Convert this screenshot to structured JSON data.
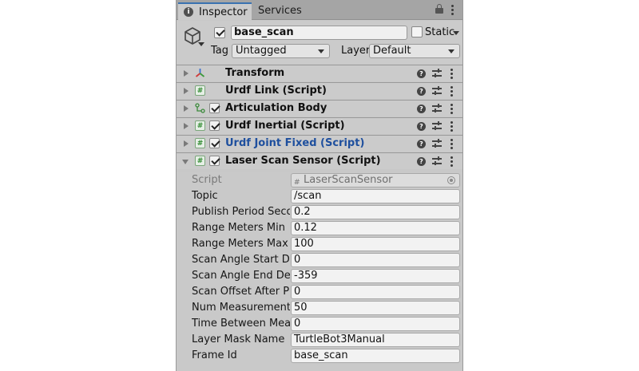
{
  "tabs": {
    "inspector": "Inspector",
    "services": "Services"
  },
  "header": {
    "object_name": "base_scan",
    "active": true,
    "static_label": "Static",
    "static_checked": false,
    "tag_label": "Tag",
    "tag_value": "Untagged",
    "layer_label": "Layer",
    "layer_value": "Default"
  },
  "components": [
    {
      "title": "Transform",
      "icon": "transform-icon",
      "has_checkbox": false,
      "checked": false
    },
    {
      "title": "Urdf Link (Script)",
      "icon": "script-icon",
      "has_checkbox": false,
      "checked": false
    },
    {
      "title": "Articulation Body",
      "icon": "articulation-icon",
      "has_checkbox": true,
      "checked": true
    },
    {
      "title": "Urdf Inertial (Script)",
      "icon": "script-icon",
      "has_checkbox": true,
      "checked": true
    },
    {
      "title": "Urdf Joint Fixed (Script)",
      "icon": "script-icon",
      "has_checkbox": true,
      "checked": true
    },
    {
      "title": "Laser Scan Sensor (Script)",
      "icon": "script-icon",
      "has_checkbox": true,
      "checked": true
    }
  ],
  "properties": [
    {
      "label": "Script",
      "value": "LaserScanSensor"
    },
    {
      "label": "Topic",
      "value": "/scan"
    },
    {
      "label": "Publish Period Seconds",
      "value": "0.2"
    },
    {
      "label": "Range Meters Min",
      "value": "0.12"
    },
    {
      "label": "Range Meters Max",
      "value": "100"
    },
    {
      "label": "Scan Angle Start Degrees",
      "value": "0"
    },
    {
      "label": "Scan Angle End Degrees",
      "value": "-359"
    },
    {
      "label": "Scan Offset After Publish",
      "value": "0"
    },
    {
      "label": "Num Measurements Per Scan",
      "value": "50"
    },
    {
      "label": "Time Between Measurements",
      "value": "0"
    },
    {
      "label": "Layer Mask Name",
      "value": "TurtleBot3Manual"
    },
    {
      "label": "Frame Id",
      "value": "base_scan"
    }
  ]
}
